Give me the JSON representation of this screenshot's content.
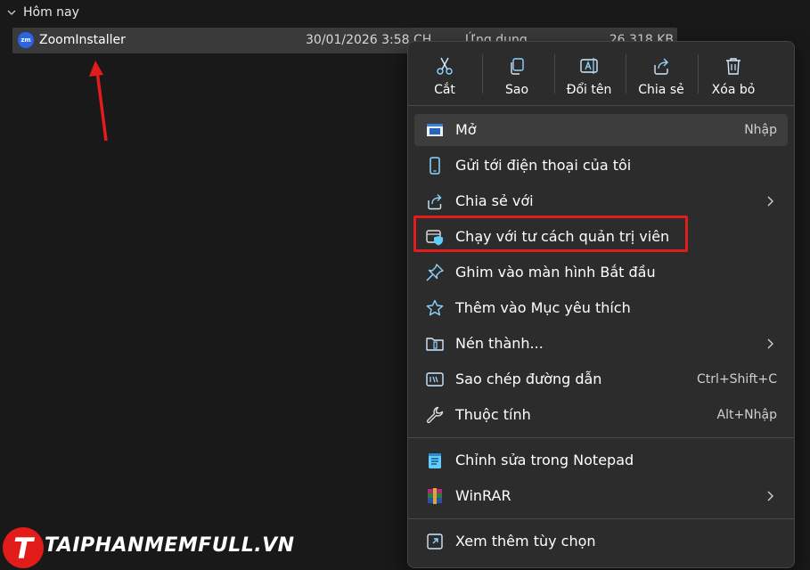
{
  "group": {
    "label": "Hôm nay"
  },
  "file": {
    "icon_text": "zm",
    "name": "ZoomInstaller",
    "date": "30/01/2026 3:58 CH",
    "type": "Ứng dụng",
    "size": "26.318 KB"
  },
  "quick_actions": [
    {
      "label": "Cắt",
      "icon": "scissors-icon"
    },
    {
      "label": "Sao",
      "icon": "copy-icon"
    },
    {
      "label": "Đổi tên",
      "icon": "rename-icon"
    },
    {
      "label": "Chia sẻ",
      "icon": "share-icon"
    },
    {
      "label": "Xóa bỏ",
      "icon": "trash-icon"
    }
  ],
  "menu_items": [
    {
      "label": "Mở",
      "shortcut": "Nhập",
      "icon": "open-window-icon"
    },
    {
      "label": "Gửi tới điện thoại của tôi",
      "icon": "phone-icon"
    },
    {
      "label": "Chia sẻ với",
      "icon": "share-with-icon",
      "submenu": true
    },
    {
      "label": "Chạy với tư cách quản trị viên",
      "icon": "admin-shield-icon"
    },
    {
      "label": "Ghim vào màn hình Bắt đầu",
      "icon": "pin-icon"
    },
    {
      "label": "Thêm vào Mục yêu thích",
      "icon": "star-icon"
    },
    {
      "label": "Nén thành...",
      "icon": "zip-folder-icon",
      "submenu": true
    },
    {
      "label": "Sao chép đường dẫn",
      "shortcut": "Ctrl+Shift+C",
      "icon": "copy-path-icon"
    },
    {
      "label": "Thuộc tính",
      "shortcut": "Alt+Nhập",
      "icon": "wrench-icon"
    },
    {
      "label": "Chỉnh sửa trong Notepad",
      "icon": "notepad-icon"
    },
    {
      "label": "WinRAR",
      "icon": "winrar-icon",
      "submenu": true
    },
    {
      "label": "Xem thêm tùy chọn",
      "icon": "more-options-icon"
    }
  ],
  "watermark": {
    "logo_letter": "T",
    "text": "TAIPHANMEMFULL.VN"
  },
  "colors": {
    "menu_bg": "#2c2c2c",
    "highlight_box": "#e21b1b",
    "accent": "#60cdff",
    "arrow": "#e21b1b"
  }
}
